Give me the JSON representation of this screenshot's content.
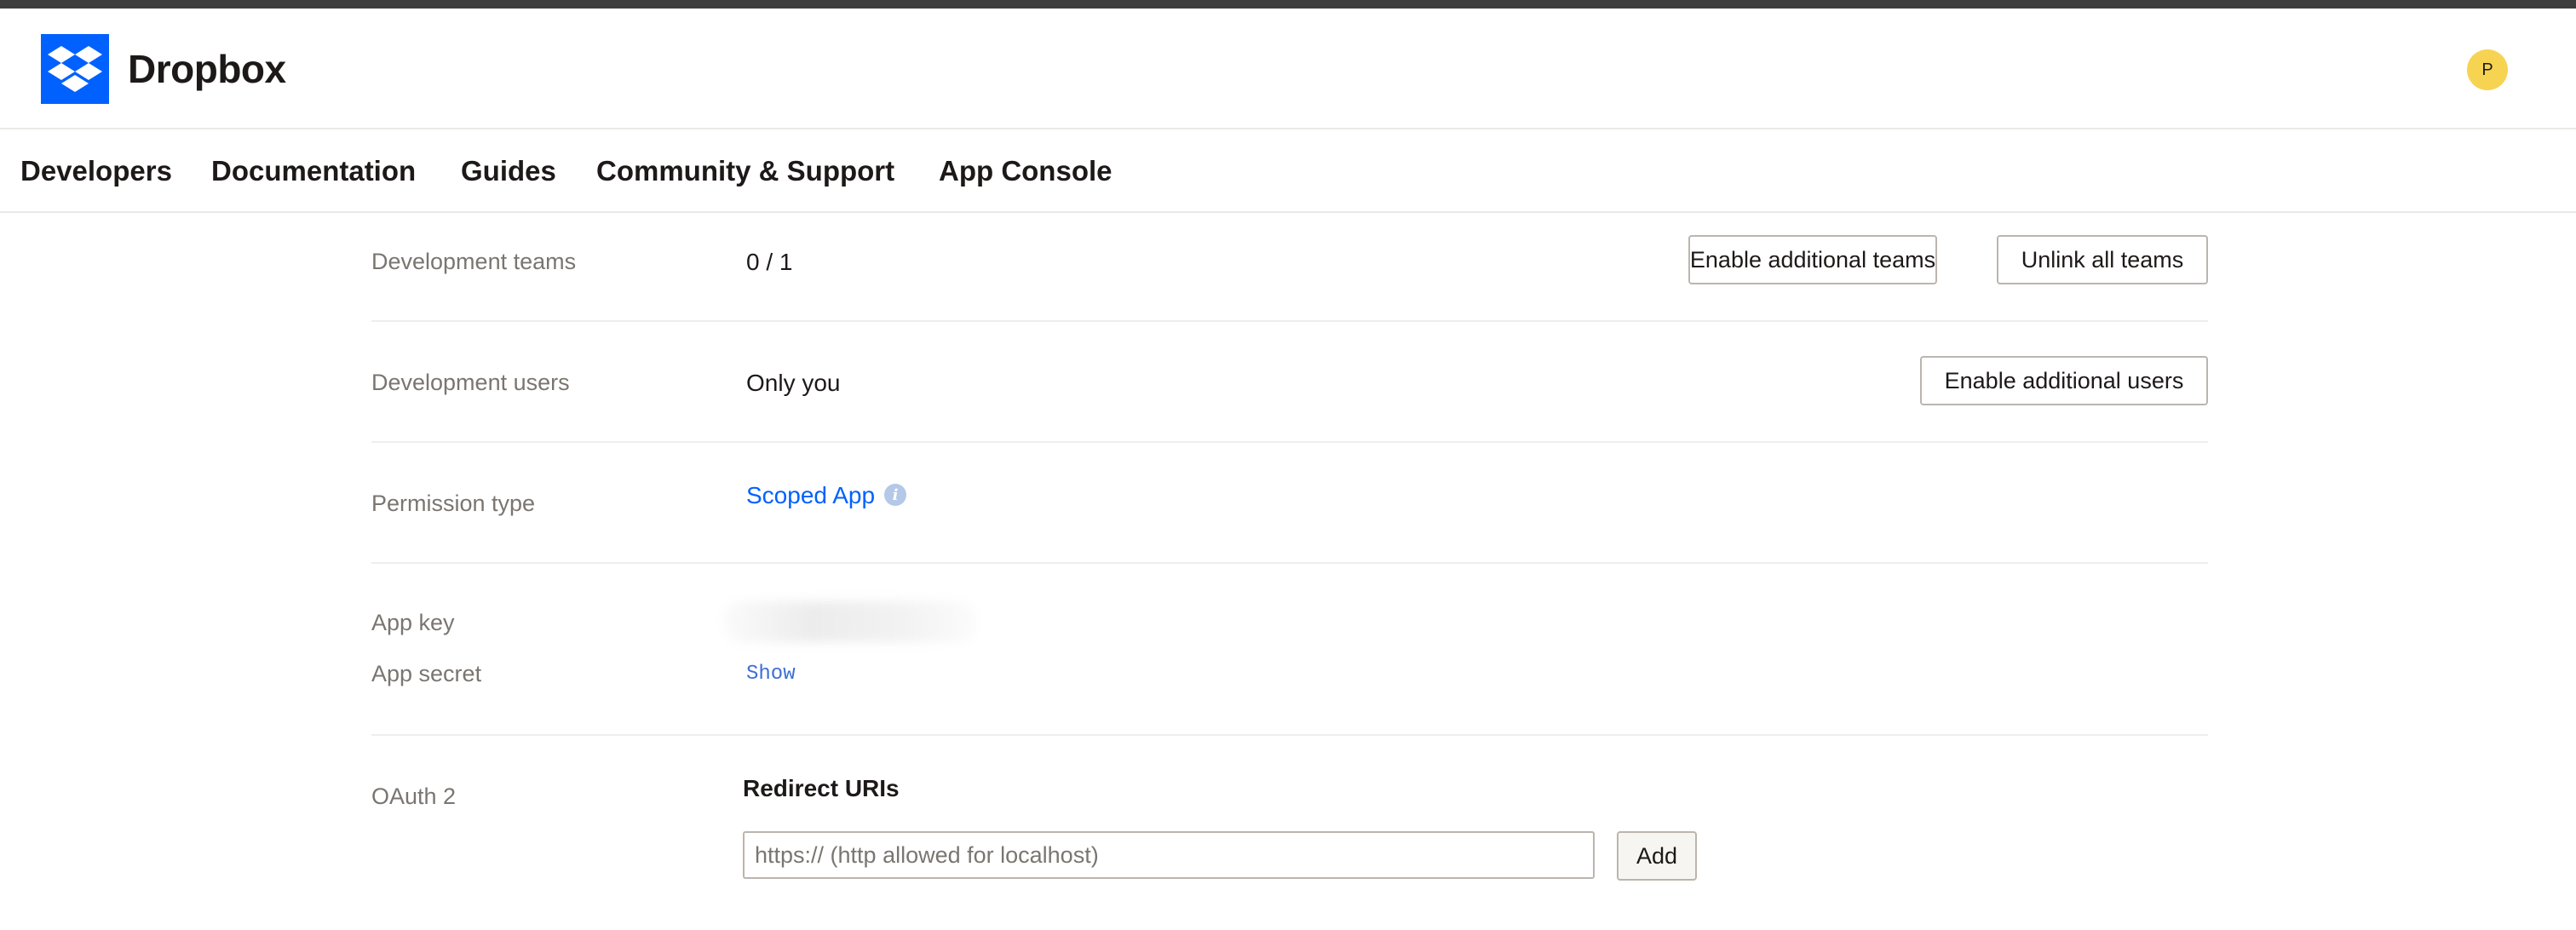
{
  "header": {
    "brand": "Dropbox",
    "avatar_initial": "P"
  },
  "nav": {
    "items": [
      {
        "label": "Developers"
      },
      {
        "label": "Documentation"
      },
      {
        "label": "Guides"
      },
      {
        "label": "Community & Support"
      },
      {
        "label": "App Console"
      }
    ]
  },
  "settings": {
    "development_teams": {
      "label": "Development teams",
      "value": "0 / 1",
      "enable_button": "Enable additional teams",
      "unlink_button": "Unlink all teams"
    },
    "development_users": {
      "label": "Development users",
      "value": "Only you",
      "enable_button": "Enable additional users"
    },
    "permission_type": {
      "label": "Permission type",
      "value": "Scoped App"
    },
    "app_key": {
      "label": "App key"
    },
    "app_secret": {
      "label": "App secret",
      "show_link": "Show"
    },
    "oauth2": {
      "label": "OAuth 2",
      "redirect_title": "Redirect URIs",
      "input_placeholder": "https:// (http allowed for localhost)",
      "add_button": "Add"
    }
  },
  "colors": {
    "brand_blue": "#0061fe",
    "avatar_yellow": "#f7d352",
    "link_blue": "#0061fe"
  },
  "icons": {
    "logo": "dropbox-logo-icon",
    "info": "info-icon"
  }
}
